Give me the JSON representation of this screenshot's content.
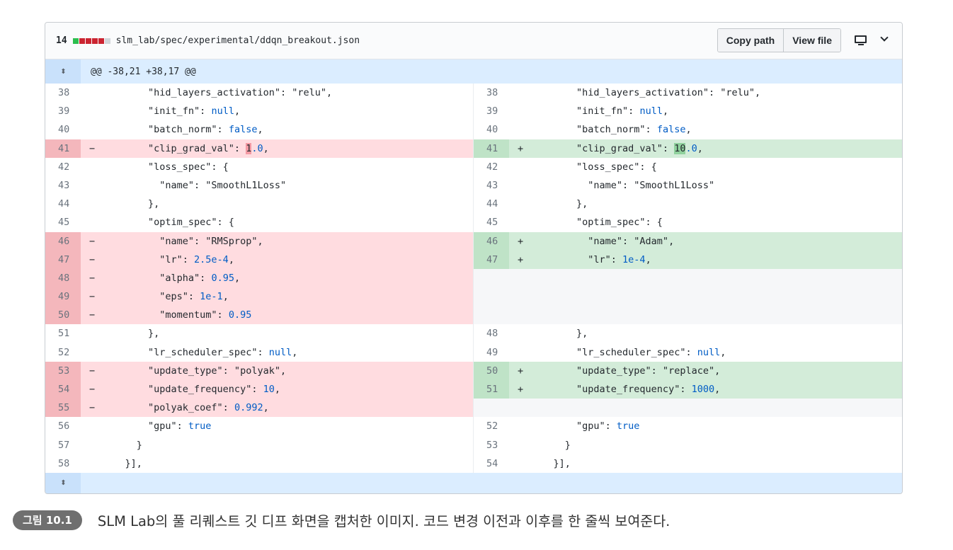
{
  "file": {
    "change_count": "14",
    "path": "slm_lab/spec/experimental/ddqn_breakout.json",
    "diffstat_colors": [
      "#2cbe4e",
      "#cb2431",
      "#cb2431",
      "#cb2431",
      "#cb2431",
      "#d1d5da"
    ],
    "copy_path_label": "Copy path",
    "view_file_label": "View file"
  },
  "hunk": {
    "header": "@@ -38,21 +38,17 @@",
    "expand_up_icon": "expand-up-icon",
    "expand_down_icon": "expand-down-icon"
  },
  "rows": [
    {
      "left": {
        "num": "38",
        "type": "ctx",
        "code": "        \"hid_layers_activation\": \"relu\","
      },
      "right": {
        "num": "38",
        "type": "ctx",
        "code": "        \"hid_layers_activation\": \"relu\","
      }
    },
    {
      "left": {
        "num": "39",
        "type": "ctx",
        "code": "        \"init_fn\": null,"
      },
      "right": {
        "num": "39",
        "type": "ctx",
        "code": "        \"init_fn\": null,"
      }
    },
    {
      "left": {
        "num": "40",
        "type": "ctx",
        "code": "        \"batch_norm\": false,"
      },
      "right": {
        "num": "40",
        "type": "ctx",
        "code": "        \"batch_norm\": false,"
      }
    },
    {
      "left": {
        "num": "41",
        "type": "del",
        "code": "        \"clip_grad_val\": 1.0,"
      },
      "right": {
        "num": "41",
        "type": "add",
        "code": "        \"clip_grad_val\": 10.0,"
      }
    },
    {
      "left": {
        "num": "42",
        "type": "ctx",
        "code": "        \"loss_spec\": {"
      },
      "right": {
        "num": "42",
        "type": "ctx",
        "code": "        \"loss_spec\": {"
      }
    },
    {
      "left": {
        "num": "43",
        "type": "ctx",
        "code": "          \"name\": \"SmoothL1Loss\""
      },
      "right": {
        "num": "43",
        "type": "ctx",
        "code": "          \"name\": \"SmoothL1Loss\""
      }
    },
    {
      "left": {
        "num": "44",
        "type": "ctx",
        "code": "        },"
      },
      "right": {
        "num": "44",
        "type": "ctx",
        "code": "        },"
      }
    },
    {
      "left": {
        "num": "45",
        "type": "ctx",
        "code": "        \"optim_spec\": {"
      },
      "right": {
        "num": "45",
        "type": "ctx",
        "code": "        \"optim_spec\": {"
      }
    },
    {
      "left": {
        "num": "46",
        "type": "del",
        "code": "          \"name\": \"RMSprop\","
      },
      "right": {
        "num": "46",
        "type": "add",
        "code": "          \"name\": \"Adam\","
      }
    },
    {
      "left": {
        "num": "47",
        "type": "del",
        "code": "          \"lr\": 2.5e-4,"
      },
      "right": {
        "num": "47",
        "type": "add",
        "code": "          \"lr\": 1e-4,"
      }
    },
    {
      "left": {
        "num": "48",
        "type": "del",
        "code": "          \"alpha\": 0.95,"
      },
      "right": {
        "num": "",
        "type": "empty",
        "code": ""
      }
    },
    {
      "left": {
        "num": "49",
        "type": "del",
        "code": "          \"eps\": 1e-1,"
      },
      "right": {
        "num": "",
        "type": "empty",
        "code": ""
      }
    },
    {
      "left": {
        "num": "50",
        "type": "del",
        "code": "          \"momentum\": 0.95"
      },
      "right": {
        "num": "",
        "type": "empty",
        "code": ""
      }
    },
    {
      "left": {
        "num": "51",
        "type": "ctx",
        "code": "        },"
      },
      "right": {
        "num": "48",
        "type": "ctx",
        "code": "        },"
      }
    },
    {
      "left": {
        "num": "52",
        "type": "ctx",
        "code": "        \"lr_scheduler_spec\": null,"
      },
      "right": {
        "num": "49",
        "type": "ctx",
        "code": "        \"lr_scheduler_spec\": null,"
      }
    },
    {
      "left": {
        "num": "53",
        "type": "del",
        "code": "        \"update_type\": \"polyak\","
      },
      "right": {
        "num": "50",
        "type": "add",
        "code": "        \"update_type\": \"replace\","
      }
    },
    {
      "left": {
        "num": "54",
        "type": "del",
        "code": "        \"update_frequency\": 10,"
      },
      "right": {
        "num": "51",
        "type": "add",
        "code": "        \"update_frequency\": 1000,"
      }
    },
    {
      "left": {
        "num": "55",
        "type": "del",
        "code": "        \"polyak_coef\": 0.992,"
      },
      "right": {
        "num": "",
        "type": "empty",
        "code": ""
      }
    },
    {
      "left": {
        "num": "56",
        "type": "ctx",
        "code": "        \"gpu\": true"
      },
      "right": {
        "num": "52",
        "type": "ctx",
        "code": "        \"gpu\": true"
      }
    },
    {
      "left": {
        "num": "57",
        "type": "ctx",
        "code": "      }"
      },
      "right": {
        "num": "53",
        "type": "ctx",
        "code": "      }"
      }
    },
    {
      "left": {
        "num": "58",
        "type": "ctx",
        "code": "    }],"
      },
      "right": {
        "num": "54",
        "type": "ctx",
        "code": "    }],"
      }
    }
  ],
  "caption": {
    "badge": "그림 10.1",
    "text": "SLM Lab의 풀 리퀘스트 깃 디프 화면을 캡처한 이미지. 코드 변경 이전과 이후를 한 줄씩 보여준다."
  }
}
